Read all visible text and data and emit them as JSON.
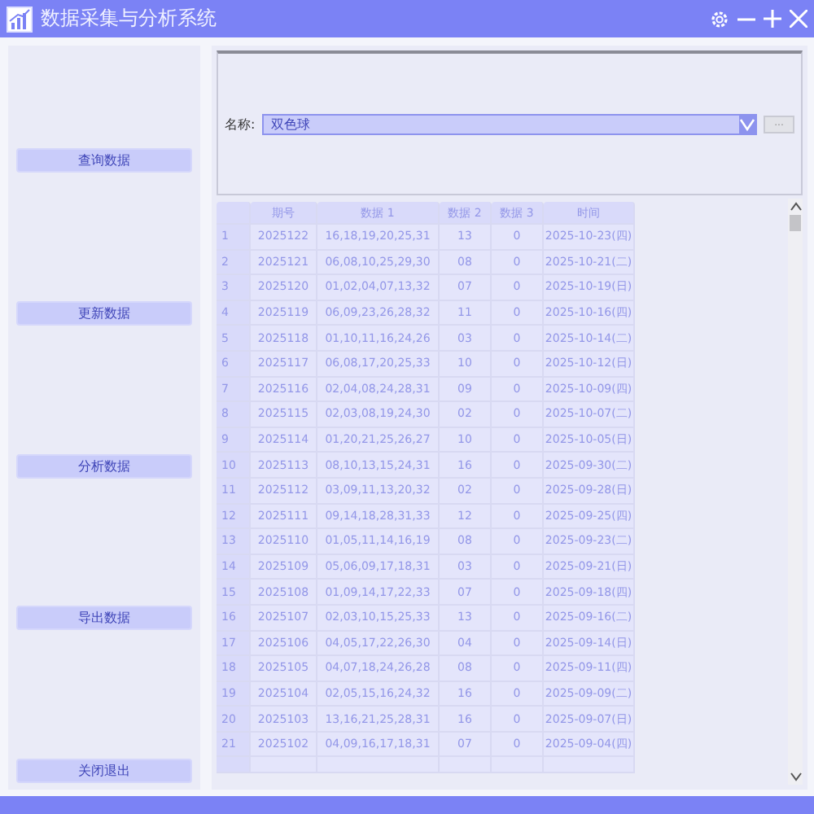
{
  "window": {
    "title": "数据采集与分析系统"
  },
  "sidebar": {
    "buttons": [
      "查询数据",
      "更新数据",
      "分析数据",
      "导出数据",
      "关闭退出"
    ]
  },
  "filter": {
    "label": "名称:",
    "value": "双色球",
    "browse_button": "..."
  },
  "table": {
    "columns": [
      "",
      "期号",
      "数据 1",
      "数据 2",
      "数据 3",
      "时间"
    ],
    "rows": [
      [
        "1",
        "2025122",
        "16,18,19,20,25,31",
        "13",
        "0",
        "2025-10-23(四)"
      ],
      [
        "2",
        "2025121",
        "06,08,10,25,29,30",
        "08",
        "0",
        "2025-10-21(二)"
      ],
      [
        "3",
        "2025120",
        "01,02,04,07,13,32",
        "07",
        "0",
        "2025-10-19(日)"
      ],
      [
        "4",
        "2025119",
        "06,09,23,26,28,32",
        "11",
        "0",
        "2025-10-16(四)"
      ],
      [
        "5",
        "2025118",
        "01,10,11,16,24,26",
        "03",
        "0",
        "2025-10-14(二)"
      ],
      [
        "6",
        "2025117",
        "06,08,17,20,25,33",
        "10",
        "0",
        "2025-10-12(日)"
      ],
      [
        "7",
        "2025116",
        "02,04,08,24,28,31",
        "09",
        "0",
        "2025-10-09(四)"
      ],
      [
        "8",
        "2025115",
        "02,03,08,19,24,30",
        "02",
        "0",
        "2025-10-07(二)"
      ],
      [
        "9",
        "2025114",
        "01,20,21,25,26,27",
        "10",
        "0",
        "2025-10-05(日)"
      ],
      [
        "10",
        "2025113",
        "08,10,13,15,24,31",
        "16",
        "0",
        "2025-09-30(二)"
      ],
      [
        "11",
        "2025112",
        "03,09,11,13,20,32",
        "02",
        "0",
        "2025-09-28(日)"
      ],
      [
        "12",
        "2025111",
        "09,14,18,28,31,33",
        "12",
        "0",
        "2025-09-25(四)"
      ],
      [
        "13",
        "2025110",
        "01,05,11,14,16,19",
        "08",
        "0",
        "2025-09-23(二)"
      ],
      [
        "14",
        "2025109",
        "05,06,09,17,18,31",
        "03",
        "0",
        "2025-09-21(日)"
      ],
      [
        "15",
        "2025108",
        "01,09,14,17,22,33",
        "07",
        "0",
        "2025-09-18(四)"
      ],
      [
        "16",
        "2025107",
        "02,03,10,15,25,33",
        "13",
        "0",
        "2025-09-16(二)"
      ],
      [
        "17",
        "2025106",
        "04,05,17,22,26,30",
        "04",
        "0",
        "2025-09-14(日)"
      ],
      [
        "18",
        "2025105",
        "04,07,18,24,26,28",
        "08",
        "0",
        "2025-09-11(四)"
      ],
      [
        "19",
        "2025104",
        "02,05,15,16,24,32",
        "16",
        "0",
        "2025-09-09(二)"
      ],
      [
        "20",
        "2025103",
        "13,16,21,25,28,31",
        "16",
        "0",
        "2025-09-07(日)"
      ],
      [
        "21",
        "2025102",
        "04,09,16,17,18,31",
        "07",
        "0",
        "2025-09-04(四)"
      ]
    ]
  }
}
